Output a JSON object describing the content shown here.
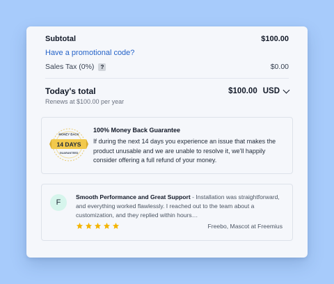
{
  "summary": {
    "subtotal_label": "Subtotal",
    "subtotal_value": "$100.00",
    "promo_link": "Have a promotional code?",
    "tax_label": "Sales Tax (0%)",
    "tax_help": "?",
    "tax_value": "$0.00"
  },
  "total": {
    "label": "Today's total",
    "amount": "$100.00",
    "currency": "USD",
    "renews": "Renews at $100.00 per year"
  },
  "guarantee": {
    "badge_top": "MONEY BACK",
    "badge_days": "14 DAYS",
    "badge_bottom": "GUARANTEED",
    "title": "100% Money Back Guarantee",
    "text": "If during the next 14 days you experience an issue that makes the product unusable and we are unable to resolve it, we'll happily consider offering a full refund of your money."
  },
  "review": {
    "avatar_letter": "F",
    "headline": "Smooth Performance and Great Support",
    "separator": " - ",
    "body": "Installation was straightforward, and everything worked flawlessly. I reached out to the team about a customization, and they replied within hours…",
    "rating": 5,
    "author": "Freebo, Mascot at Freemius"
  },
  "colors": {
    "background": "#a7cbfb",
    "link": "#2563c8",
    "star": "#f4b400",
    "badge_gold": "#f2c94c",
    "avatar_bg": "#d6f5ec"
  }
}
